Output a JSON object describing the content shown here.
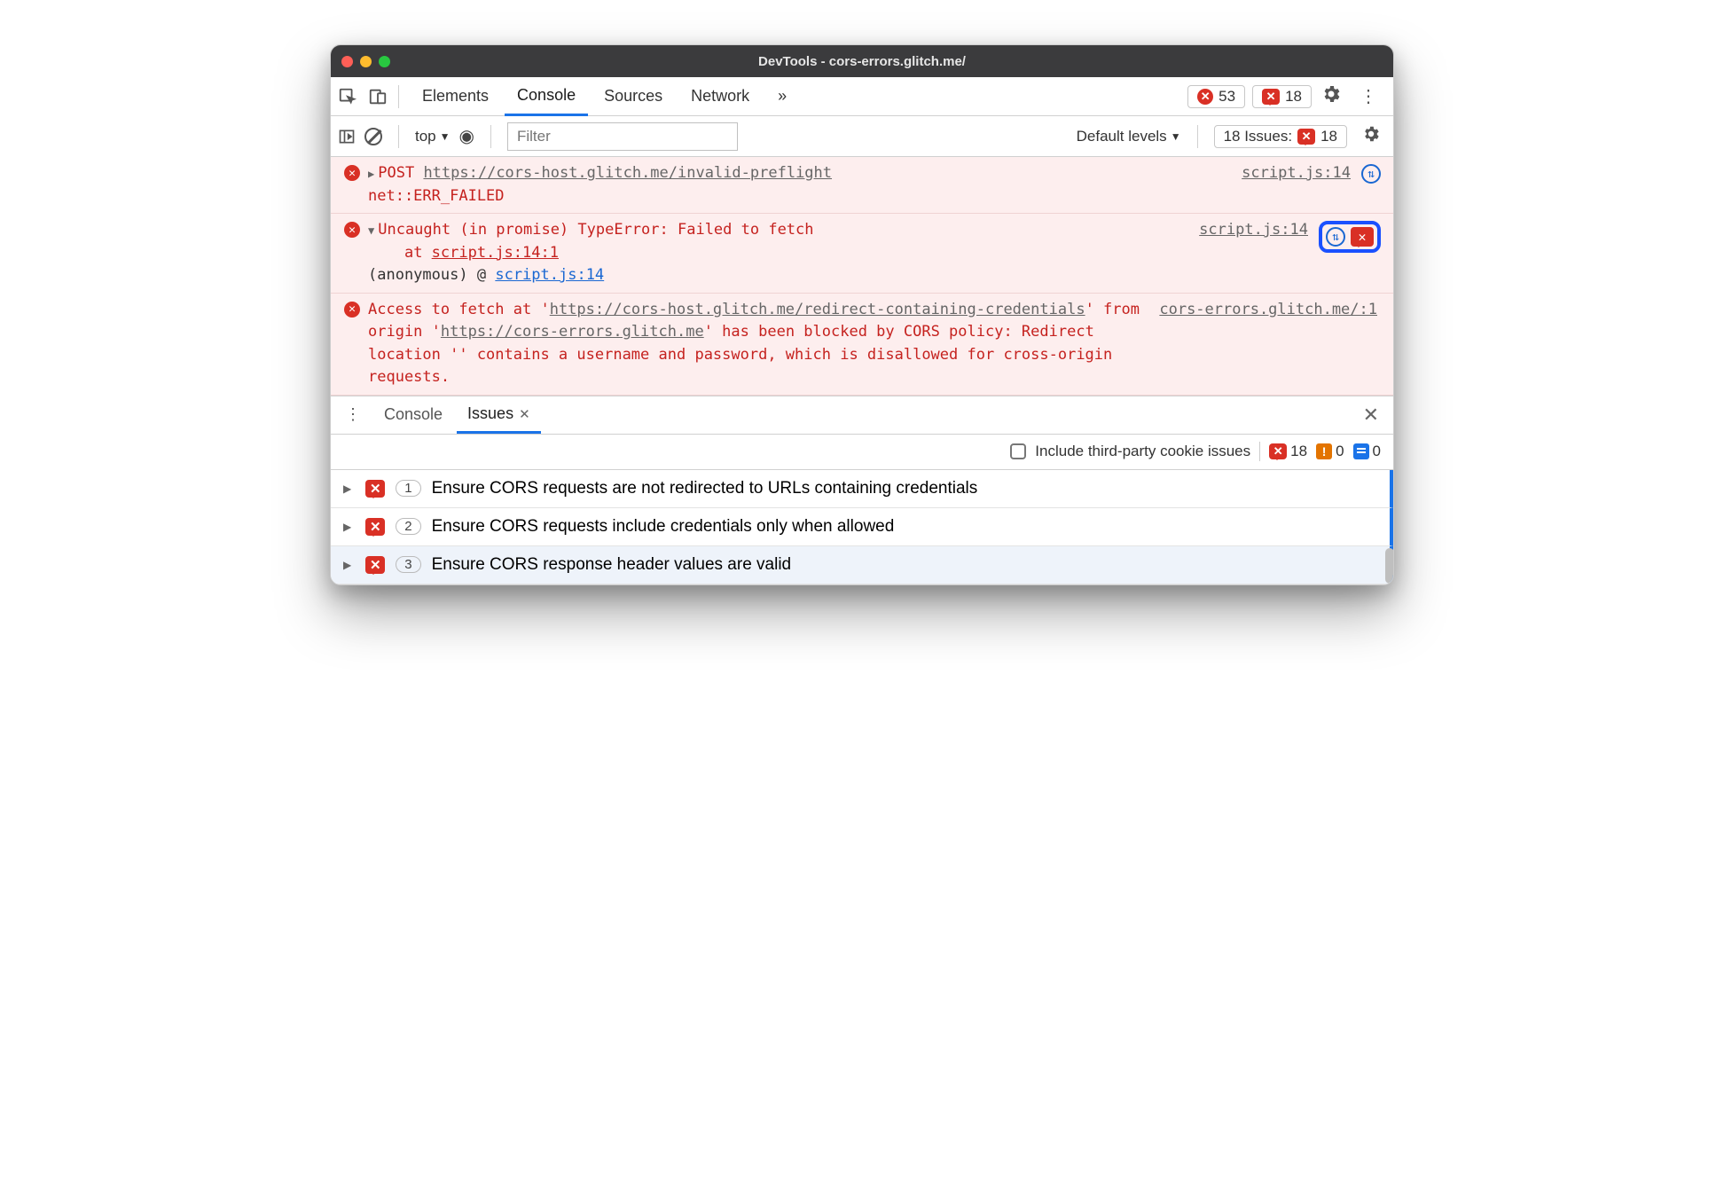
{
  "window": {
    "title": "DevTools - cors-errors.glitch.me/"
  },
  "tabs": {
    "items": [
      "Elements",
      "Console",
      "Sources",
      "Network"
    ],
    "overflow": "»",
    "active": "Console"
  },
  "topbar": {
    "error_count": "53",
    "issue_count": "18"
  },
  "filterbar": {
    "context": "top",
    "filter_placeholder": "Filter",
    "levels_label": "Default levels",
    "issues_label": "18 Issues:",
    "issues_count": "18"
  },
  "console": {
    "rows": [
      {
        "method": "POST",
        "url": "https://cors-host.glitch.me/invalid-preflight",
        "status": "net::ERR_FAILED",
        "source": "script.js:14"
      },
      {
        "message": "Uncaught (in promise) TypeError: Failed to fetch",
        "at_prefix": "at ",
        "at_link": "script.js:14:1",
        "anon_label": "(anonymous)",
        "anon_sep": "@",
        "anon_link": "script.js:14",
        "source": "script.js:14"
      },
      {
        "source": "cors-errors.glitch.me/:1",
        "p1": "Access to fetch at '",
        "u1": "https://cors-host.glitch.me/redirect-containing-credentials",
        "p2": "' from origin '",
        "u2": "https://cors-errors.glitch.me",
        "p3": "' has been blocked by CORS policy: Redirect location '' contains a username and password, which is disallowed for cross-origin requests."
      }
    ]
  },
  "drawer": {
    "tabs": [
      "Console",
      "Issues"
    ],
    "active": "Issues"
  },
  "issues": {
    "checkbox_label": "Include third-party cookie issues",
    "counts": {
      "errors": "18",
      "warnings": "0",
      "info": "0"
    },
    "list": [
      {
        "count": "1",
        "title": "Ensure CORS requests are not redirected to URLs containing credentials"
      },
      {
        "count": "2",
        "title": "Ensure CORS requests include credentials only when allowed"
      },
      {
        "count": "3",
        "title": "Ensure CORS response header values are valid"
      }
    ]
  }
}
